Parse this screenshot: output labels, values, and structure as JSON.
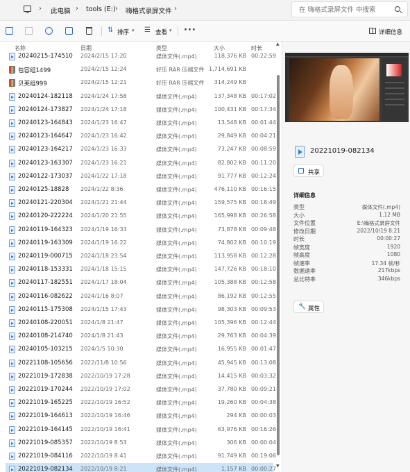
{
  "address": {
    "crumbs": [
      "此电脑",
      "tools (E:)",
      "嗨格式录屏文件"
    ],
    "search_placeholder": "在 嗨格式录屏文件 中搜索"
  },
  "toolbar": {
    "sort_label": "排序",
    "view_label": "查看",
    "more_label": "···",
    "details_label": "详细信息"
  },
  "columns": {
    "name": "名称",
    "date": "日期",
    "type": "类型",
    "size": "大小",
    "duration": "时长"
  },
  "files": [
    {
      "name": "20240215-174510",
      "date": "2024/2/15 17:20",
      "type": "媒体文件(.mp4)",
      "size": "118,376 KB",
      "duration": "00:22:59",
      "kind": "video"
    },
    {
      "name": "包容组1499",
      "date": "2024/2/15 12:24",
      "type": "好压 RAR 压缩文件",
      "size": "1,714,691 KB",
      "duration": "",
      "kind": "rar"
    },
    {
      "name": "贝芙组999",
      "date": "2024/2/15 12:21",
      "type": "好压 RAR 压缩文件",
      "size": "314,249 KB",
      "duration": "",
      "kind": "rar"
    },
    {
      "name": "20240124-182118",
      "date": "2024/1/24 17:58",
      "type": "媒体文件(.mp4)",
      "size": "137,348 KB",
      "duration": "00:17:02",
      "kind": "video"
    },
    {
      "name": "20240124-173827",
      "date": "2024/1/24 17:18",
      "type": "媒体文件(.mp4)",
      "size": "100,431 KB",
      "duration": "00:17:34",
      "kind": "video"
    },
    {
      "name": "20240123-164843",
      "date": "2024/1/23 16:47",
      "type": "媒体文件(.mp4)",
      "size": "13,548 KB",
      "duration": "00:01:44",
      "kind": "video"
    },
    {
      "name": "20240123-164647",
      "date": "2024/1/23 16:42",
      "type": "媒体文件(.mp4)",
      "size": "29,849 KB",
      "duration": "00:04:21",
      "kind": "video"
    },
    {
      "name": "20240123-164217",
      "date": "2024/1/23 16:33",
      "type": "媒体文件(.mp4)",
      "size": "73,247 KB",
      "duration": "00:08:59",
      "kind": "video"
    },
    {
      "name": "20240123-163307",
      "date": "2024/1/23 16:21",
      "type": "媒体文件(.mp4)",
      "size": "82,802 KB",
      "duration": "00:11:20",
      "kind": "video"
    },
    {
      "name": "20240122-173037",
      "date": "2024/1/22 17:18",
      "type": "媒体文件(.mp4)",
      "size": "91,777 KB",
      "duration": "00:12:24",
      "kind": "video"
    },
    {
      "name": "20240125-18828",
      "date": "2024/1/22 8:36",
      "type": "媒体文件(.mp4)",
      "size": "476,110 KB",
      "duration": "00:16:15",
      "kind": "video"
    },
    {
      "name": "20240121-220304",
      "date": "2024/1/21 21:44",
      "type": "媒体文件(.mp4)",
      "size": "159,575 KB",
      "duration": "00:18:49",
      "kind": "video"
    },
    {
      "name": "20240120-222224",
      "date": "2024/1/20 21:55",
      "type": "媒体文件(.mp4)",
      "size": "165,998 KB",
      "duration": "00:26:58",
      "kind": "video"
    },
    {
      "name": "20240119-164323",
      "date": "2024/1/19 16:33",
      "type": "媒体文件(.mp4)",
      "size": "73,878 KB",
      "duration": "00:09:48",
      "kind": "video"
    },
    {
      "name": "20240119-163309",
      "date": "2024/1/19 16:22",
      "type": "媒体文件(.mp4)",
      "size": "74,802 KB",
      "duration": "00:10:19",
      "kind": "video"
    },
    {
      "name": "20240119-000715",
      "date": "2024/1/18 23:54",
      "type": "媒体文件(.mp4)",
      "size": "113,958 KB",
      "duration": "00:12:28",
      "kind": "video"
    },
    {
      "name": "20240118-153331",
      "date": "2024/1/18 15:15",
      "type": "媒体文件(.mp4)",
      "size": "147,726 KB",
      "duration": "00:18:10",
      "kind": "video"
    },
    {
      "name": "20240117-182551",
      "date": "2024/1/17 18:04",
      "type": "媒体文件(.mp4)",
      "size": "105,388 KB",
      "duration": "00:12:58",
      "kind": "video"
    },
    {
      "name": "20240116-082622",
      "date": "2024/1/16 8:07",
      "type": "媒体文件(.mp4)",
      "size": "86,192 KB",
      "duration": "00:12:55",
      "kind": "video"
    },
    {
      "name": "20240115-175308",
      "date": "2024/1/15 17:43",
      "type": "媒体文件(.mp4)",
      "size": "98,303 KB",
      "duration": "00:09:53",
      "kind": "video"
    },
    {
      "name": "20240108-220051",
      "date": "2024/1/8 21:47",
      "type": "媒体文件(.mp4)",
      "size": "105,396 KB",
      "duration": "00:12:44",
      "kind": "video"
    },
    {
      "name": "20240108-214740",
      "date": "2024/1/8 21:43",
      "type": "媒体文件(.mp4)",
      "size": "29,763 KB",
      "duration": "00:04:39",
      "kind": "video"
    },
    {
      "name": "20240105-103215",
      "date": "2024/1/5 10:30",
      "type": "媒体文件(.mp4)",
      "size": "16,955 KB",
      "duration": "00:01:47",
      "kind": "video"
    },
    {
      "name": "20221108-105656",
      "date": "2022/11/8 10:56",
      "type": "媒体文件(.mp4)",
      "size": "45,945 KB",
      "duration": "00:13:08",
      "kind": "video"
    },
    {
      "name": "20221019-172838",
      "date": "2022/10/19 17:28",
      "type": "媒体文件(.mp4)",
      "size": "14,415 KB",
      "duration": "00:03:32",
      "kind": "video"
    },
    {
      "name": "20221019-170244",
      "date": "2022/10/19 17:02",
      "type": "媒体文件(.mp4)",
      "size": "37,780 KB",
      "duration": "00:09:21",
      "kind": "video"
    },
    {
      "name": "20221019-165225",
      "date": "2022/10/19 16:52",
      "type": "媒体文件(.mp4)",
      "size": "19,260 KB",
      "duration": "00:04:38",
      "kind": "video"
    },
    {
      "name": "20221019-164613",
      "date": "2022/10/19 16:46",
      "type": "媒体文件(.mp4)",
      "size": "294 KB",
      "duration": "00:00:03",
      "kind": "video"
    },
    {
      "name": "20221019-164145",
      "date": "2022/10/19 16:41",
      "type": "媒体文件(.mp4)",
      "size": "63,976 KB",
      "duration": "00:16:26",
      "kind": "video"
    },
    {
      "name": "20221019-085357",
      "date": "2022/10/19 8:53",
      "type": "媒体文件(.mp4)",
      "size": "306 KB",
      "duration": "00:00:04",
      "kind": "video"
    },
    {
      "name": "20221019-084116",
      "date": "2022/10/19 8:41",
      "type": "媒体文件(.mp4)",
      "size": "91,749 KB",
      "duration": "00:19:06",
      "kind": "video"
    },
    {
      "name": "20221019-082134",
      "date": "2022/10/19 8:21",
      "type": "媒体文件(.mp4)",
      "size": "1,157 KB",
      "duration": "00:00:27",
      "kind": "video",
      "selected": true
    }
  ],
  "details": {
    "title": "20221019-082134",
    "share_label": "共享",
    "section_title": "详细信息",
    "props": [
      {
        "label": "类型",
        "value": "媒体文件(.mp4)"
      },
      {
        "label": "大小",
        "value": "1.12 MB"
      },
      {
        "label": "文件位置",
        "value": "E:\\嗨格式录屏文件"
      },
      {
        "label": "修改日期",
        "value": "2022/10/19 8:21"
      },
      {
        "label": "时长",
        "value": "00:00:27"
      },
      {
        "label": "帧宽度",
        "value": "1920"
      },
      {
        "label": "帧高度",
        "value": "1080"
      },
      {
        "label": "帧速率",
        "value": "17.34 帧/秒"
      },
      {
        "label": "数据速率",
        "value": "217kbps"
      },
      {
        "label": "总比特率",
        "value": "346kbps"
      }
    ],
    "properties_label": "属性"
  },
  "colors": {
    "selection": "#cce4f7",
    "accent": "#2a6fcf"
  }
}
